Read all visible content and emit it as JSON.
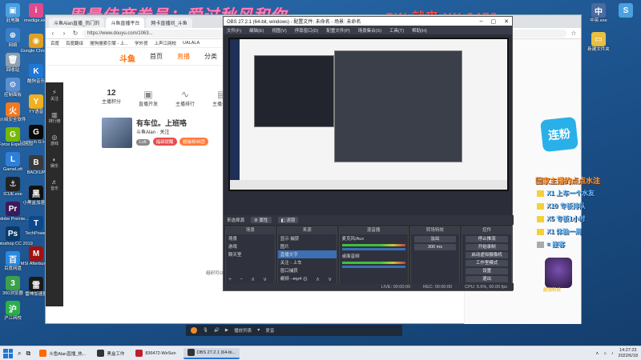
{
  "banners": {
    "top_left": "周最佳商券员：爱过秋风和你",
    "top_right": "CW 就来 YY 6473"
  },
  "desktop_icons": [
    {
      "label": "此电脑",
      "color": "#4aa0e0",
      "glyph": "▣"
    },
    {
      "label": "网络",
      "color": "#3a7fc8",
      "glyph": "⊕"
    },
    {
      "label": "回收站",
      "color": "#8fa0b0",
      "glyph": "🗑"
    },
    {
      "label": "控制面板",
      "color": "#5a8fd0",
      "glyph": "⚙"
    },
    {
      "label": "火绒安全软件",
      "color": "#f07a20",
      "glyph": "火"
    },
    {
      "label": "GeForce Experience",
      "color": "#76b900",
      "glyph": "G"
    },
    {
      "label": "GameLoft",
      "color": "#2f7fd8",
      "glyph": "L"
    },
    {
      "label": "ICUE.exe",
      "color": "#222",
      "glyph": "⚓"
    },
    {
      "label": "Adobe Premie...",
      "color": "#3a1a5a",
      "glyph": "Pr"
    },
    {
      "label": "Photoshop CC 2019",
      "color": "#0a3a6a",
      "glyph": "Ps"
    },
    {
      "label": "百度网盘",
      "color": "#2a8ae0",
      "glyph": "百"
    },
    {
      "label": "360浏览器",
      "color": "#3aa04a",
      "glyph": "3"
    },
    {
      "label": "沪江网校",
      "color": "#2ab04a",
      "glyph": "沪"
    }
  ],
  "desktop_icons_col2": [
    {
      "label": "imedige.exe",
      "color": "#e04a8a",
      "glyph": "i"
    },
    {
      "label": "Google Chrome",
      "color": "#e0a020",
      "glyph": "◉"
    },
    {
      "label": "酷狗音乐",
      "color": "#1e78d6",
      "glyph": "K"
    },
    {
      "label": "YY语音",
      "color": "#f0b020",
      "glyph": "Y"
    },
    {
      "label": "Logitech G HUB",
      "color": "#0a0a0a",
      "glyph": "G"
    },
    {
      "label": "BACKUP",
      "color": "#3a3a3a",
      "glyph": "B"
    },
    {
      "label": "小黑盒加速器",
      "color": "#111",
      "glyph": "黑"
    },
    {
      "label": "TechPower",
      "color": "#0a4a8a",
      "glyph": "T"
    },
    {
      "label": "MSI Afterburner",
      "color": "#a01010",
      "glyph": "M"
    },
    {
      "label": "雷神加速器",
      "color": "#1a1a1a",
      "glyph": "雷"
    }
  ],
  "right_icons": [
    {
      "label": "中英.exe",
      "color": "#4a6aa0",
      "glyph": "中"
    },
    {
      "label": "新建文件夹",
      "color": "#e8c040",
      "glyph": "▭"
    },
    {
      "label": "",
      "color": "#4aa0e0",
      "glyph": "S"
    }
  ],
  "browser": {
    "tabs": [
      {
        "label": "斗鱼Alan直播_热门的",
        "active": false
      },
      {
        "label": "斗鱼直播平台",
        "active": true
      },
      {
        "label": "网卡直播间_斗鱼",
        "active": false
      }
    ],
    "url": "https://www.douyu.com/1063..."
  },
  "bookmarks": [
    "百度",
    "百度翻译",
    "搜狗搜索引擎 - 上...",
    "学外贸",
    "上声江网校",
    "UALALA"
  ],
  "site": {
    "logo": "斗鱼",
    "nav": [
      "首页",
      "直播",
      "分类"
    ],
    "side": [
      {
        "g": "⚡",
        "l": "关注"
      },
      {
        "g": "▥",
        "l": "排行榜"
      },
      {
        "g": "◎",
        "l": "游戏"
      },
      {
        "g": "◐",
        "l": "娱乐"
      },
      {
        "g": "♬",
        "l": "音乐"
      }
    ],
    "stats": [
      {
        "n": "12",
        "l": "主播积分"
      },
      {
        "g": "▣",
        "l": "直播开发"
      },
      {
        "g": "∿",
        "l": "主播排行"
      },
      {
        "g": "▤",
        "l": "主播公告"
      }
    ],
    "anchor_title": "有车位。上班咯",
    "anchor_sub": "斗鱼Alan · 关注",
    "chips": [
      {
        "t": "Lv6",
        "c": "#8a8a8a"
      },
      {
        "t": "福袋提醒",
        "c": "#e84a4a"
      },
      {
        "t": "超级粉丝团",
        "c": "#ff7a3a"
      }
    ],
    "footnote": "组织可以..."
  },
  "obs": {
    "title": "OBS 27.2.1 (64-bit, windows) - 配置文件: 未命名 - 场景: 未命名",
    "menu": [
      "文件(F)",
      "编辑(E)",
      "视图(V)",
      "停靠窗口(D)",
      "配置文件(P)",
      "场景集合(S)",
      "工具(T)",
      "帮助(H)"
    ],
    "scene_bar": {
      "label": "来选择源",
      "btn1": "属性",
      "btn2": "滤镜"
    },
    "docks": {
      "scenes": {
        "title": "场景",
        "items": [
          "场景",
          "游戏",
          "聊天室"
        ]
      },
      "sources": {
        "title": "来源",
        "items": [
          "显示 捕获",
          "图片",
          "直播文字",
          "关注 - 上车",
          "窗口捕获",
          "视频 - mp4"
        ]
      },
      "mixer": {
        "title": "混音器",
        "items": [
          "麦克风/Aux",
          "桌面音频"
        ]
      },
      "transitions": {
        "title": "转场特效",
        "type": "淡出",
        "duration": "300 ms"
      },
      "controls": {
        "title": "控件",
        "buttons": [
          "停止推流",
          "开始录制",
          "启动虚拟摄像机",
          "工作室模式",
          "设置",
          "退出"
        ]
      }
    },
    "status": [
      "LIVE: 00:00:00",
      "REC: 00:00:00",
      "CPU: 5.6%, 60.00 fps"
    ]
  },
  "overlay": {
    "badge": "连粉",
    "title": "回家主播的点点水注",
    "lines": [
      "X1 上车一个水友",
      "X10 专板排队",
      "X5 专板1小时",
      "X1 体验一局"
    ],
    "extra": "= 接客",
    "mascot_label": "超强粉丝"
  },
  "media_bar": {
    "label": "播放列表",
    "count": "爱音"
  },
  "taskbar": {
    "apps": [
      {
        "label": "斗鱼Alan直播_热...",
        "color": "#ff6a00",
        "active": false
      },
      {
        "label": "黑盒工作",
        "color": "#333",
        "active": false
      },
      {
        "label": "836472-WeSun",
        "color": "#c0202a",
        "active": false
      },
      {
        "label": "OBS 27.2.1 (64-bi...",
        "color": "#333",
        "active": true
      }
    ],
    "time": "14:27:23",
    "date": "2022/6/18"
  }
}
